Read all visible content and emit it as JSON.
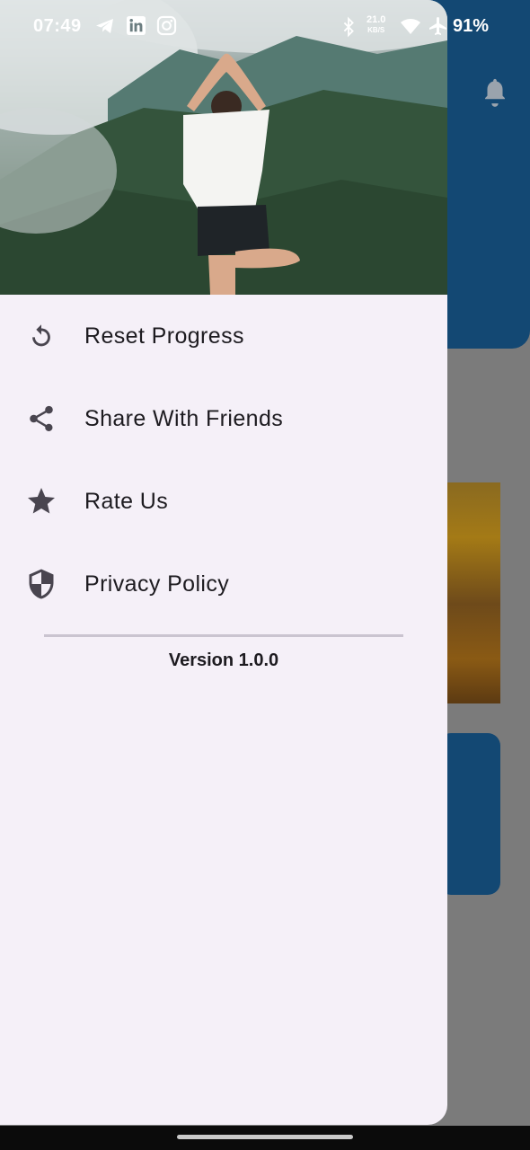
{
  "status_bar": {
    "time": "07:49",
    "net_speed_value": "21.0",
    "net_speed_unit": "KB/S",
    "battery": "91%"
  },
  "drawer": {
    "menu_items": [
      {
        "label": "Reset Progress",
        "icon": "reset-icon"
      },
      {
        "label": "Share With Friends",
        "icon": "share-icon"
      },
      {
        "label": "Rate Us",
        "icon": "star-icon"
      },
      {
        "label": "Privacy Policy",
        "icon": "shield-icon"
      }
    ],
    "version": "Version 1.0.0"
  },
  "colors": {
    "drawer_bg": "#f5f0f8",
    "header_blue": "#134873",
    "scrim": "#7b7b7b",
    "icon": "#49454f",
    "text": "#1d1b20"
  }
}
